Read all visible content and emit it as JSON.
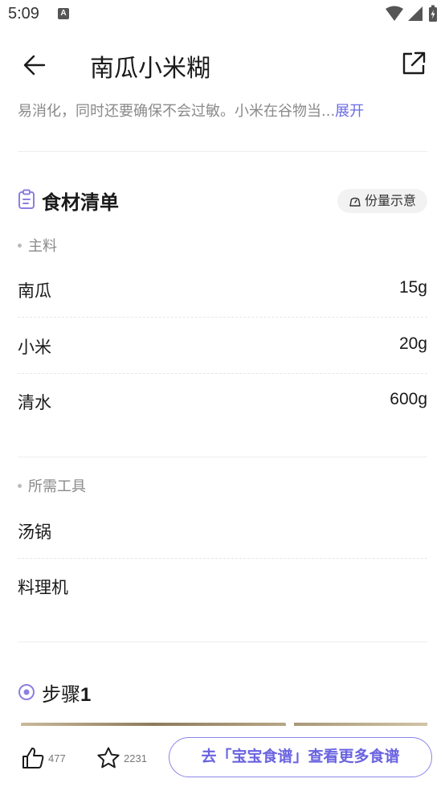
{
  "status_bar": {
    "time": "5:09",
    "notification_glyph": "A"
  },
  "header": {
    "title": "南瓜小米糊",
    "back_icon": "arrow-left-icon",
    "share_icon": "share-external-icon"
  },
  "description": {
    "text": "易消化，同时还要确保不会过敏。小米在谷物当...",
    "expand_label": "展开"
  },
  "ingredients": {
    "title": "食材清单",
    "portion_button": "份量示意",
    "main_label": "主料",
    "main_items": [
      {
        "name": "南瓜",
        "qty": "15g"
      },
      {
        "name": "小米",
        "qty": "20g"
      },
      {
        "name": "清水",
        "qty": "600g"
      }
    ],
    "tools_label": "所需工具",
    "tools": [
      {
        "name": "汤锅"
      },
      {
        "name": "料理机"
      }
    ]
  },
  "step": {
    "label": "步骤",
    "number": "1"
  },
  "bottom_bar": {
    "like_count": "477",
    "favorite_count": "2231",
    "cta_label": "去「宝宝食谱」查看更多食谱"
  },
  "colors": {
    "accent": "#6b6be6",
    "muted_text": "#8a8a8a",
    "clipboard_icon": "#8b7fe0",
    "step_icon": "#8b7fe0"
  }
}
